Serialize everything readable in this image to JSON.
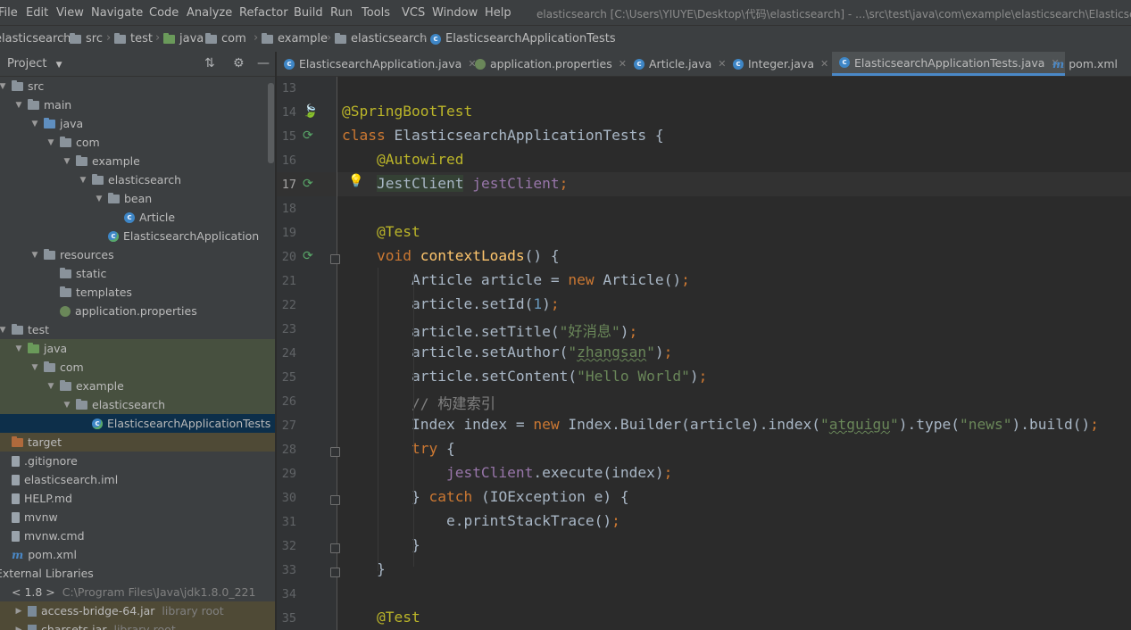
{
  "menu": {
    "items": [
      "File",
      "Edit",
      "View",
      "Navigate",
      "Code",
      "Analyze",
      "Refactor",
      "Build",
      "Run",
      "Tools",
      "VCS",
      "Window",
      "Help"
    ],
    "window_title": "elasticsearch [C:\\Users\\YIUYE\\Desktop\\代码\\elasticsearch] - ...\\src\\test\\java\\com\\example\\elasticsearch\\ElasticsearchApplicationTests.java"
  },
  "breadcrumb": [
    "elasticsearch",
    "src",
    "test",
    "java",
    "com",
    "example",
    "elasticsearch",
    "ElasticsearchApplicationTests"
  ],
  "project_panel": {
    "title": "Project",
    "tree": [
      {
        "label": "src",
        "depth": 0,
        "arrow": "▼",
        "icon": "folder"
      },
      {
        "label": "main",
        "depth": 1,
        "arrow": "▼",
        "icon": "folder"
      },
      {
        "label": "java",
        "depth": 2,
        "arrow": "▼",
        "icon": "source-folder"
      },
      {
        "label": "com",
        "depth": 3,
        "arrow": "▼",
        "icon": "package"
      },
      {
        "label": "example",
        "depth": 4,
        "arrow": "▼",
        "icon": "package"
      },
      {
        "label": "elasticsearch",
        "depth": 5,
        "arrow": "▼",
        "icon": "package"
      },
      {
        "label": "bean",
        "depth": 6,
        "arrow": "▼",
        "icon": "package"
      },
      {
        "label": "Article",
        "depth": 7,
        "arrow": "",
        "icon": "class"
      },
      {
        "label": "ElasticsearchApplication",
        "depth": 6,
        "arrow": "",
        "icon": "spring-class"
      },
      {
        "label": "resources",
        "depth": 2,
        "arrow": "▼",
        "icon": "resources-folder"
      },
      {
        "label": "static",
        "depth": 3,
        "arrow": "",
        "icon": "folder"
      },
      {
        "label": "templates",
        "depth": 3,
        "arrow": "",
        "icon": "folder"
      },
      {
        "label": "application.properties",
        "depth": 3,
        "arrow": "",
        "icon": "properties"
      },
      {
        "label": "test",
        "depth": 0,
        "arrow": "▼",
        "icon": "folder"
      },
      {
        "label": "java",
        "depth": 1,
        "arrow": "▼",
        "icon": "test-folder"
      },
      {
        "label": "com",
        "depth": 2,
        "arrow": "▼",
        "icon": "package"
      },
      {
        "label": "example",
        "depth": 3,
        "arrow": "▼",
        "icon": "package"
      },
      {
        "label": "elasticsearch",
        "depth": 4,
        "arrow": "▼",
        "icon": "package"
      },
      {
        "label": "ElasticsearchApplicationTests",
        "depth": 5,
        "arrow": "",
        "icon": "spring-class"
      },
      {
        "label": "target",
        "depth": 0,
        "arrow": "",
        "icon": "excluded-folder"
      },
      {
        "label": ".gitignore",
        "depth": 0,
        "arrow": "",
        "icon": "file"
      },
      {
        "label": "elasticsearch.iml",
        "depth": 0,
        "arrow": "",
        "icon": "file"
      },
      {
        "label": "HELP.md",
        "depth": 0,
        "arrow": "",
        "icon": "md-file"
      },
      {
        "label": "mvnw",
        "depth": 0,
        "arrow": "",
        "icon": "file"
      },
      {
        "label": "mvnw.cmd",
        "depth": 0,
        "arrow": "",
        "icon": "file"
      },
      {
        "label": "pom.xml",
        "depth": 0,
        "arrow": "",
        "icon": "maven-file"
      },
      {
        "label": "External Libraries",
        "depth": -1,
        "arrow": "",
        "icon": "library"
      },
      {
        "label": "< 1.8 >",
        "depth": 0,
        "arrow": "",
        "icon": "library",
        "extra": "C:\\Program Files\\Java\\jdk1.8.0_221"
      },
      {
        "label": "access-bridge-64.jar",
        "depth": 1,
        "arrow": "▶",
        "icon": "jar",
        "extra": "library root"
      },
      {
        "label": "charsets.jar",
        "depth": 1,
        "arrow": "▶",
        "icon": "jar",
        "extra": "library root"
      }
    ]
  },
  "tabs": [
    {
      "label": "ElasticsearchApplication.java",
      "icon": "spring-class",
      "active": false
    },
    {
      "label": "application.properties",
      "icon": "properties",
      "active": false
    },
    {
      "label": "Article.java",
      "icon": "class",
      "active": false
    },
    {
      "label": "Integer.java",
      "icon": "class",
      "active": false
    },
    {
      "label": "ElasticsearchApplicationTests.java",
      "icon": "spring-class",
      "active": true
    },
    {
      "label": "pom.xml",
      "icon": "maven-file",
      "active": false
    }
  ],
  "editor": {
    "current_line": 17,
    "lines": [
      {
        "n": 13,
        "tokens": []
      },
      {
        "n": 14,
        "tokens": [
          [
            "annot",
            "@SpringBootTest"
          ]
        ]
      },
      {
        "n": 15,
        "tokens": [
          [
            "kw",
            "class "
          ],
          [
            "txt",
            "ElasticsearchApplicationTests {"
          ]
        ]
      },
      {
        "n": 16,
        "tokens": [
          [
            "txt",
            "    "
          ],
          [
            "annot",
            "@Autowired"
          ]
        ]
      },
      {
        "n": 17,
        "tokens": [
          [
            "txt",
            "    "
          ],
          [
            "ref",
            "JestClient"
          ],
          [
            "txt",
            " "
          ],
          [
            "fld",
            "jestClient"
          ],
          [
            "kw",
            ";"
          ]
        ]
      },
      {
        "n": 18,
        "tokens": []
      },
      {
        "n": 19,
        "tokens": [
          [
            "txt",
            "    "
          ],
          [
            "annot",
            "@Test"
          ]
        ]
      },
      {
        "n": 20,
        "tokens": [
          [
            "txt",
            "    "
          ],
          [
            "kw",
            "void "
          ],
          [
            "fn",
            "contextLoads"
          ],
          [
            "txt",
            "() {"
          ]
        ]
      },
      {
        "n": 21,
        "tokens": [
          [
            "txt",
            "        Article article = "
          ],
          [
            "kw",
            "new "
          ],
          [
            "txt",
            "Article()"
          ],
          [
            "kw",
            ";"
          ]
        ]
      },
      {
        "n": 22,
        "tokens": [
          [
            "txt",
            "        article.setId("
          ],
          [
            "num",
            "1"
          ],
          [
            "txt",
            ")"
          ],
          [
            "kw",
            ";"
          ]
        ]
      },
      {
        "n": 23,
        "tokens": [
          [
            "txt",
            "        article.setTitle("
          ],
          [
            "str",
            "\"好消息\""
          ],
          [
            "txt",
            ")"
          ],
          [
            "kw",
            ";"
          ]
        ]
      },
      {
        "n": 24,
        "tokens": [
          [
            "txt",
            "        article.setAuthor("
          ],
          [
            "str",
            "\""
          ],
          [
            "strsq",
            "zhangsan"
          ],
          [
            "str",
            "\""
          ],
          [
            "txt",
            ")"
          ],
          [
            "kw",
            ";"
          ]
        ]
      },
      {
        "n": 25,
        "tokens": [
          [
            "txt",
            "        article.setContent("
          ],
          [
            "str",
            "\"Hello World\""
          ],
          [
            "txt",
            ")"
          ],
          [
            "kw",
            ";"
          ]
        ]
      },
      {
        "n": 26,
        "tokens": [
          [
            "txt",
            "        "
          ],
          [
            "cmt",
            "// 构建索引"
          ]
        ]
      },
      {
        "n": 27,
        "tokens": [
          [
            "txt",
            "        Index index = "
          ],
          [
            "kw",
            "new "
          ],
          [
            "txt",
            "Index.Builder(article).index("
          ],
          [
            "str",
            "\""
          ],
          [
            "strsq",
            "atguigu"
          ],
          [
            "str",
            "\""
          ],
          [
            "txt",
            ").type("
          ],
          [
            "str",
            "\"news\""
          ],
          [
            "txt",
            ").build()"
          ],
          [
            "kw",
            ";"
          ]
        ]
      },
      {
        "n": 28,
        "tokens": [
          [
            "txt",
            "        "
          ],
          [
            "kw",
            "try "
          ],
          [
            "txt",
            "{"
          ]
        ]
      },
      {
        "n": 29,
        "tokens": [
          [
            "txt",
            "            "
          ],
          [
            "fld",
            "jestClient"
          ],
          [
            "txt",
            ".execute(index)"
          ],
          [
            "kw",
            ";"
          ]
        ]
      },
      {
        "n": 30,
        "tokens": [
          [
            "txt",
            "        } "
          ],
          [
            "kw",
            "catch "
          ],
          [
            "txt",
            "(IOException e) {"
          ]
        ]
      },
      {
        "n": 31,
        "tokens": [
          [
            "txt",
            "            e.printStackTrace()"
          ],
          [
            "kw",
            ";"
          ]
        ]
      },
      {
        "n": 32,
        "tokens": [
          [
            "txt",
            "        }"
          ]
        ]
      },
      {
        "n": 33,
        "tokens": [
          [
            "txt",
            "    }"
          ]
        ]
      },
      {
        "n": 34,
        "tokens": []
      },
      {
        "n": 35,
        "tokens": [
          [
            "txt",
            "    "
          ],
          [
            "annot",
            "@Test"
          ]
        ]
      }
    ]
  }
}
